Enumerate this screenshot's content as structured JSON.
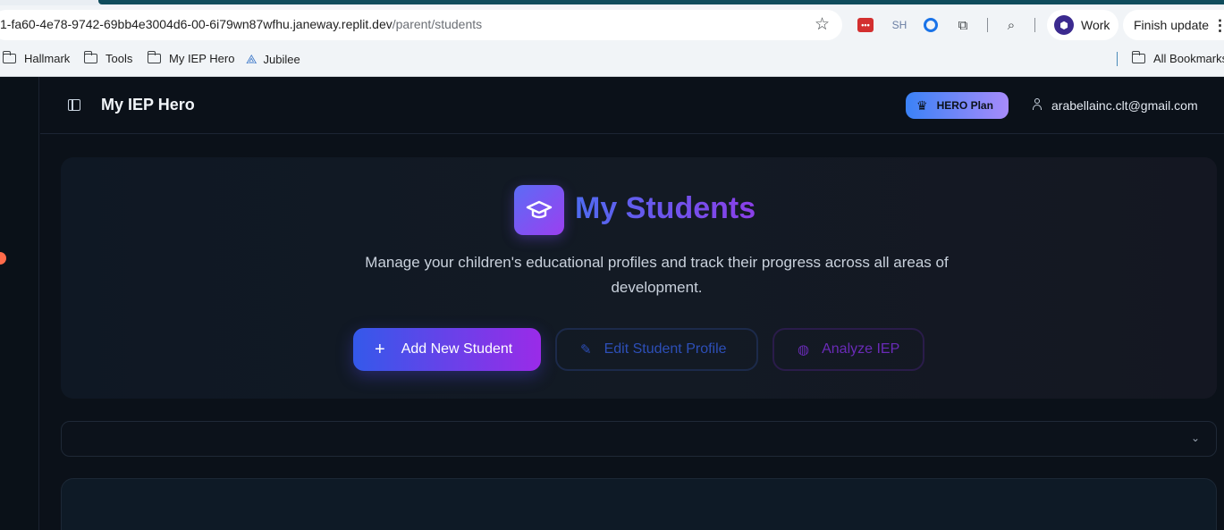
{
  "browser": {
    "url_host": "1-fa60-4e78-9742-69bb4e3004d6-00-6i79wn87wfhu.janeway.replit.dev",
    "url_path": "/parent/students",
    "extensions": {
      "red_icon_text": "•••",
      "sh_label": "SH"
    },
    "profile_label": "Work",
    "finish_update_label": "Finish update",
    "bookmarks": [
      {
        "label": "Hallmark",
        "icon": "folder-icon"
      },
      {
        "label": "Tools",
        "icon": "folder-icon"
      },
      {
        "label": "My IEP Hero",
        "icon": "folder-icon"
      },
      {
        "label": "Jubilee",
        "icon": "jubilee-icon"
      }
    ],
    "all_bookmarks_label": "All Bookmarks"
  },
  "app": {
    "title": "My IEP Hero",
    "plan_badge": "HERO Plan",
    "user_email": "arabellainc.clt@gmail.com",
    "hero": {
      "title": "My Students",
      "description": "Manage your children's educational profiles and track their progress across all areas of development.",
      "add_student_label": "Add New Student",
      "edit_profile_label": "Edit Student Profile",
      "analyze_label": "Analyze IEP"
    },
    "student_select": {
      "value": ""
    }
  },
  "colors": {
    "app_bg": "#0b1119",
    "accent_blue": "#3459ea",
    "accent_purple": "#9a2be8",
    "plan_gradient_start": "#3b82f6",
    "plan_gradient_end": "#a78bfa"
  }
}
